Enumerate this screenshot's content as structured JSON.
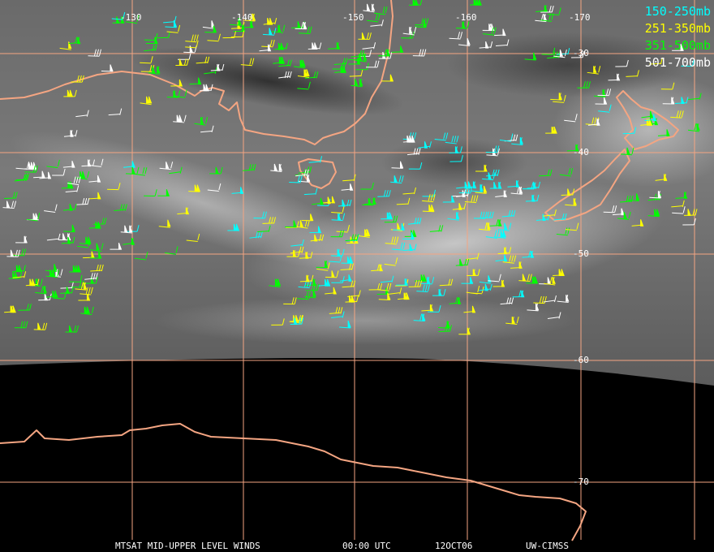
{
  "map": {
    "longitude_labels": [
      "-130",
      "-140",
      "-150",
      "-160",
      "-170"
    ],
    "latitude_labels": [
      "-30",
      "-40",
      "-50",
      "-60",
      "-70"
    ],
    "legend": [
      {
        "label": "150-250mb",
        "color": "#00ffff"
      },
      {
        "label": "251-350mb",
        "color": "#ffff00"
      },
      {
        "label": "351-500mb",
        "color": "#00ff00"
      },
      {
        "label": "501-700mb",
        "color": "#ffffff"
      }
    ],
    "footer": {
      "product": "MTSAT MID-UPPER LEVEL WINDS",
      "time": "00:00 UTC",
      "date": "12OCT06",
      "source": "UW-CIMSS"
    },
    "colors": {
      "coastline": "#f4a582",
      "gridline": "#f4a582",
      "background": "#000000"
    }
  }
}
